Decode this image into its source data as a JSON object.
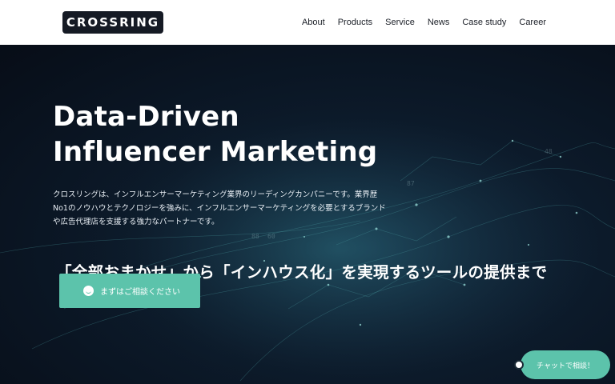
{
  "header": {
    "logo_text": "CROSSRING",
    "nav": [
      "About",
      "Products",
      "Service",
      "News",
      "Case study",
      "Career"
    ]
  },
  "hero": {
    "headline_line1": "Data-Driven",
    "headline_line2": "Influencer Marketing",
    "description_line1": "クロスリングは、インフルエンサーマーケティング業界のリーディングカンパニーです。業界歴",
    "description_line2": "No1のノウハウとテクノロジーを強みに、インフルエンサーマーケティングを必要とするブランド",
    "description_line3": "や広告代理店を支援する強力なパートナーです。",
    "tagline": "「全部おまかせ」から「インハウス化」を実現するツールの提供まで",
    "cta_label": "まずはご相談ください",
    "cta_icon": "smile-icon",
    "background_numbers": [
      "88",
      "60",
      "87",
      "48"
    ]
  },
  "chat": {
    "label": "チャットで相談！"
  },
  "colors": {
    "accent": "#5cc3ab",
    "logo_bg": "#151a24",
    "hero_bg": "#0b1420"
  }
}
